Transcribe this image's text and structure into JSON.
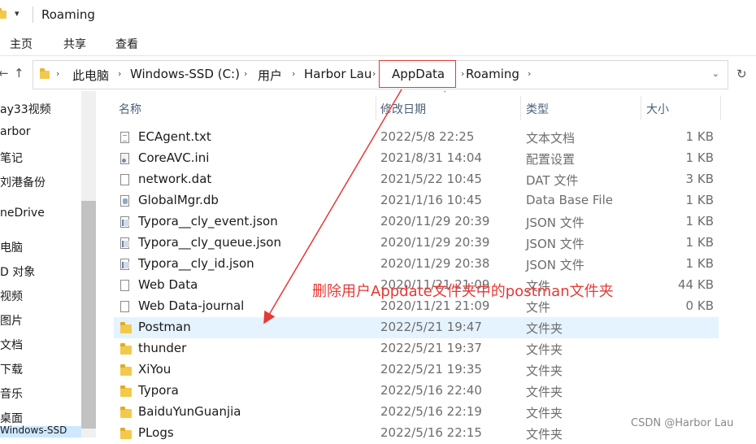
{
  "window": {
    "title": "Roaming",
    "qat_dropdown": "▾"
  },
  "ribbon": {
    "tabs": [
      "主页",
      "共享",
      "查看"
    ]
  },
  "nav": {
    "back": "←",
    "up": "↑",
    "refresh": "↻",
    "address_dropdown": "⌄",
    "crumb_sep": "›"
  },
  "address": {
    "crumbs": [
      "此电脑",
      "Windows-SSD (C:)",
      "用户",
      "Harbor Lau",
      "AppData",
      "Roaming"
    ],
    "highlighted": "AppData"
  },
  "sidebar": {
    "items": [
      "ay33视频",
      "arbor",
      "笔记",
      "刘港备份",
      "neDrive",
      "电脑",
      "D 对象",
      "视频",
      "图片",
      "文档",
      "下载",
      "音乐",
      "桌面"
    ],
    "bottom_partial": "Windows-SSD"
  },
  "columns": {
    "name": "名称",
    "date": "修改日期",
    "type": "类型",
    "size": "大小",
    "sort_indicator": "ˇ"
  },
  "files": [
    {
      "name": "ECAgent.txt",
      "date": "2022/5/8 22:25",
      "type": "文本文档",
      "size": "1 KB",
      "icon": "text-file-icon"
    },
    {
      "name": "CoreAVC.ini",
      "date": "2021/8/31 14:04",
      "type": "配置设置",
      "size": "1 KB",
      "icon": "config-file-icon"
    },
    {
      "name": "network.dat",
      "date": "2021/5/22 10:45",
      "type": "DAT 文件",
      "size": "3 KB",
      "icon": "blank-file-icon"
    },
    {
      "name": "GlobalMgr.db",
      "date": "2021/1/16 10:45",
      "type": "Data Base File",
      "size": "1 KB",
      "icon": "database-file-icon"
    },
    {
      "name": "Typora__cly_event.json",
      "date": "2020/11/29 20:39",
      "type": "JSON 文件",
      "size": "1 KB",
      "icon": "json-file-icon"
    },
    {
      "name": "Typora__cly_queue.json",
      "date": "2020/11/29 20:39",
      "type": "JSON 文件",
      "size": "1 KB",
      "icon": "json-file-icon"
    },
    {
      "name": "Typora__cly_id.json",
      "date": "2020/11/29 20:38",
      "type": "JSON 文件",
      "size": "1 KB",
      "icon": "json-file-icon"
    },
    {
      "name": "Web Data",
      "date": "2020/11/21 21:09",
      "type": "文件",
      "size": "44 KB",
      "icon": "blank-file-icon"
    },
    {
      "name": "Web Data-journal",
      "date": "2020/11/21 21:09",
      "type": "文件",
      "size": "0 KB",
      "icon": "blank-file-icon"
    },
    {
      "name": "Postman",
      "date": "2022/5/21 19:47",
      "type": "文件夹",
      "size": "",
      "icon": "folder-icon",
      "selected": true
    },
    {
      "name": "thunder",
      "date": "2022/5/21 19:37",
      "type": "文件夹",
      "size": "",
      "icon": "folder-icon"
    },
    {
      "name": "XiYou",
      "date": "2022/5/21 19:35",
      "type": "文件夹",
      "size": "",
      "icon": "folder-icon"
    },
    {
      "name": "Typora",
      "date": "2022/5/16 22:40",
      "type": "文件夹",
      "size": "",
      "icon": "folder-icon"
    },
    {
      "name": "BaiduYunGuanjia",
      "date": "2022/5/16 22:19",
      "type": "文件夹",
      "size": "",
      "icon": "folder-icon"
    },
    {
      "name": "PLogs",
      "date": "2022/5/16 22:15",
      "type": "文件夹",
      "size": "",
      "icon": "folder-icon"
    }
  ],
  "annotation": {
    "text": "删除用户Appdate文件夹中的postman文件夹",
    "color": "#e53935"
  },
  "watermark": "CSDN @Harbor Lau",
  "colors": {
    "selection": "#e5f3ff",
    "header_text": "#4c607a",
    "folder": "#f2c94c",
    "annotation_red": "#e53935"
  }
}
